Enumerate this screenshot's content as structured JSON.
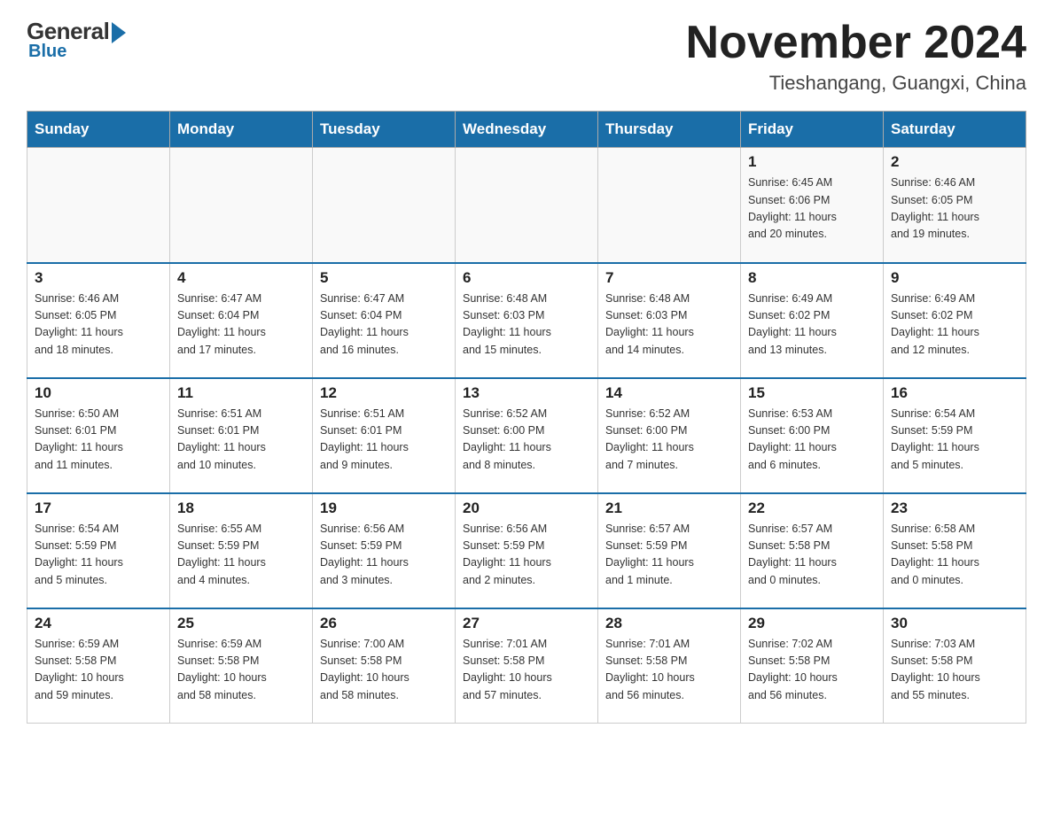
{
  "header": {
    "logo": {
      "general": "General",
      "blue": "Blue"
    },
    "title": "November 2024",
    "location": "Tieshangang, Guangxi, China"
  },
  "days_of_week": [
    "Sunday",
    "Monday",
    "Tuesday",
    "Wednesday",
    "Thursday",
    "Friday",
    "Saturday"
  ],
  "weeks": [
    [
      {
        "day": "",
        "info": ""
      },
      {
        "day": "",
        "info": ""
      },
      {
        "day": "",
        "info": ""
      },
      {
        "day": "",
        "info": ""
      },
      {
        "day": "",
        "info": ""
      },
      {
        "day": "1",
        "info": "Sunrise: 6:45 AM\nSunset: 6:06 PM\nDaylight: 11 hours\nand 20 minutes."
      },
      {
        "day": "2",
        "info": "Sunrise: 6:46 AM\nSunset: 6:05 PM\nDaylight: 11 hours\nand 19 minutes."
      }
    ],
    [
      {
        "day": "3",
        "info": "Sunrise: 6:46 AM\nSunset: 6:05 PM\nDaylight: 11 hours\nand 18 minutes."
      },
      {
        "day": "4",
        "info": "Sunrise: 6:47 AM\nSunset: 6:04 PM\nDaylight: 11 hours\nand 17 minutes."
      },
      {
        "day": "5",
        "info": "Sunrise: 6:47 AM\nSunset: 6:04 PM\nDaylight: 11 hours\nand 16 minutes."
      },
      {
        "day": "6",
        "info": "Sunrise: 6:48 AM\nSunset: 6:03 PM\nDaylight: 11 hours\nand 15 minutes."
      },
      {
        "day": "7",
        "info": "Sunrise: 6:48 AM\nSunset: 6:03 PM\nDaylight: 11 hours\nand 14 minutes."
      },
      {
        "day": "8",
        "info": "Sunrise: 6:49 AM\nSunset: 6:02 PM\nDaylight: 11 hours\nand 13 minutes."
      },
      {
        "day": "9",
        "info": "Sunrise: 6:49 AM\nSunset: 6:02 PM\nDaylight: 11 hours\nand 12 minutes."
      }
    ],
    [
      {
        "day": "10",
        "info": "Sunrise: 6:50 AM\nSunset: 6:01 PM\nDaylight: 11 hours\nand 11 minutes."
      },
      {
        "day": "11",
        "info": "Sunrise: 6:51 AM\nSunset: 6:01 PM\nDaylight: 11 hours\nand 10 minutes."
      },
      {
        "day": "12",
        "info": "Sunrise: 6:51 AM\nSunset: 6:01 PM\nDaylight: 11 hours\nand 9 minutes."
      },
      {
        "day": "13",
        "info": "Sunrise: 6:52 AM\nSunset: 6:00 PM\nDaylight: 11 hours\nand 8 minutes."
      },
      {
        "day": "14",
        "info": "Sunrise: 6:52 AM\nSunset: 6:00 PM\nDaylight: 11 hours\nand 7 minutes."
      },
      {
        "day": "15",
        "info": "Sunrise: 6:53 AM\nSunset: 6:00 PM\nDaylight: 11 hours\nand 6 minutes."
      },
      {
        "day": "16",
        "info": "Sunrise: 6:54 AM\nSunset: 5:59 PM\nDaylight: 11 hours\nand 5 minutes."
      }
    ],
    [
      {
        "day": "17",
        "info": "Sunrise: 6:54 AM\nSunset: 5:59 PM\nDaylight: 11 hours\nand 5 minutes."
      },
      {
        "day": "18",
        "info": "Sunrise: 6:55 AM\nSunset: 5:59 PM\nDaylight: 11 hours\nand 4 minutes."
      },
      {
        "day": "19",
        "info": "Sunrise: 6:56 AM\nSunset: 5:59 PM\nDaylight: 11 hours\nand 3 minutes."
      },
      {
        "day": "20",
        "info": "Sunrise: 6:56 AM\nSunset: 5:59 PM\nDaylight: 11 hours\nand 2 minutes."
      },
      {
        "day": "21",
        "info": "Sunrise: 6:57 AM\nSunset: 5:59 PM\nDaylight: 11 hours\nand 1 minute."
      },
      {
        "day": "22",
        "info": "Sunrise: 6:57 AM\nSunset: 5:58 PM\nDaylight: 11 hours\nand 0 minutes."
      },
      {
        "day": "23",
        "info": "Sunrise: 6:58 AM\nSunset: 5:58 PM\nDaylight: 11 hours\nand 0 minutes."
      }
    ],
    [
      {
        "day": "24",
        "info": "Sunrise: 6:59 AM\nSunset: 5:58 PM\nDaylight: 10 hours\nand 59 minutes."
      },
      {
        "day": "25",
        "info": "Sunrise: 6:59 AM\nSunset: 5:58 PM\nDaylight: 10 hours\nand 58 minutes."
      },
      {
        "day": "26",
        "info": "Sunrise: 7:00 AM\nSunset: 5:58 PM\nDaylight: 10 hours\nand 58 minutes."
      },
      {
        "day": "27",
        "info": "Sunrise: 7:01 AM\nSunset: 5:58 PM\nDaylight: 10 hours\nand 57 minutes."
      },
      {
        "day": "28",
        "info": "Sunrise: 7:01 AM\nSunset: 5:58 PM\nDaylight: 10 hours\nand 56 minutes."
      },
      {
        "day": "29",
        "info": "Sunrise: 7:02 AM\nSunset: 5:58 PM\nDaylight: 10 hours\nand 56 minutes."
      },
      {
        "day": "30",
        "info": "Sunrise: 7:03 AM\nSunset: 5:58 PM\nDaylight: 10 hours\nand 55 minutes."
      }
    ]
  ]
}
